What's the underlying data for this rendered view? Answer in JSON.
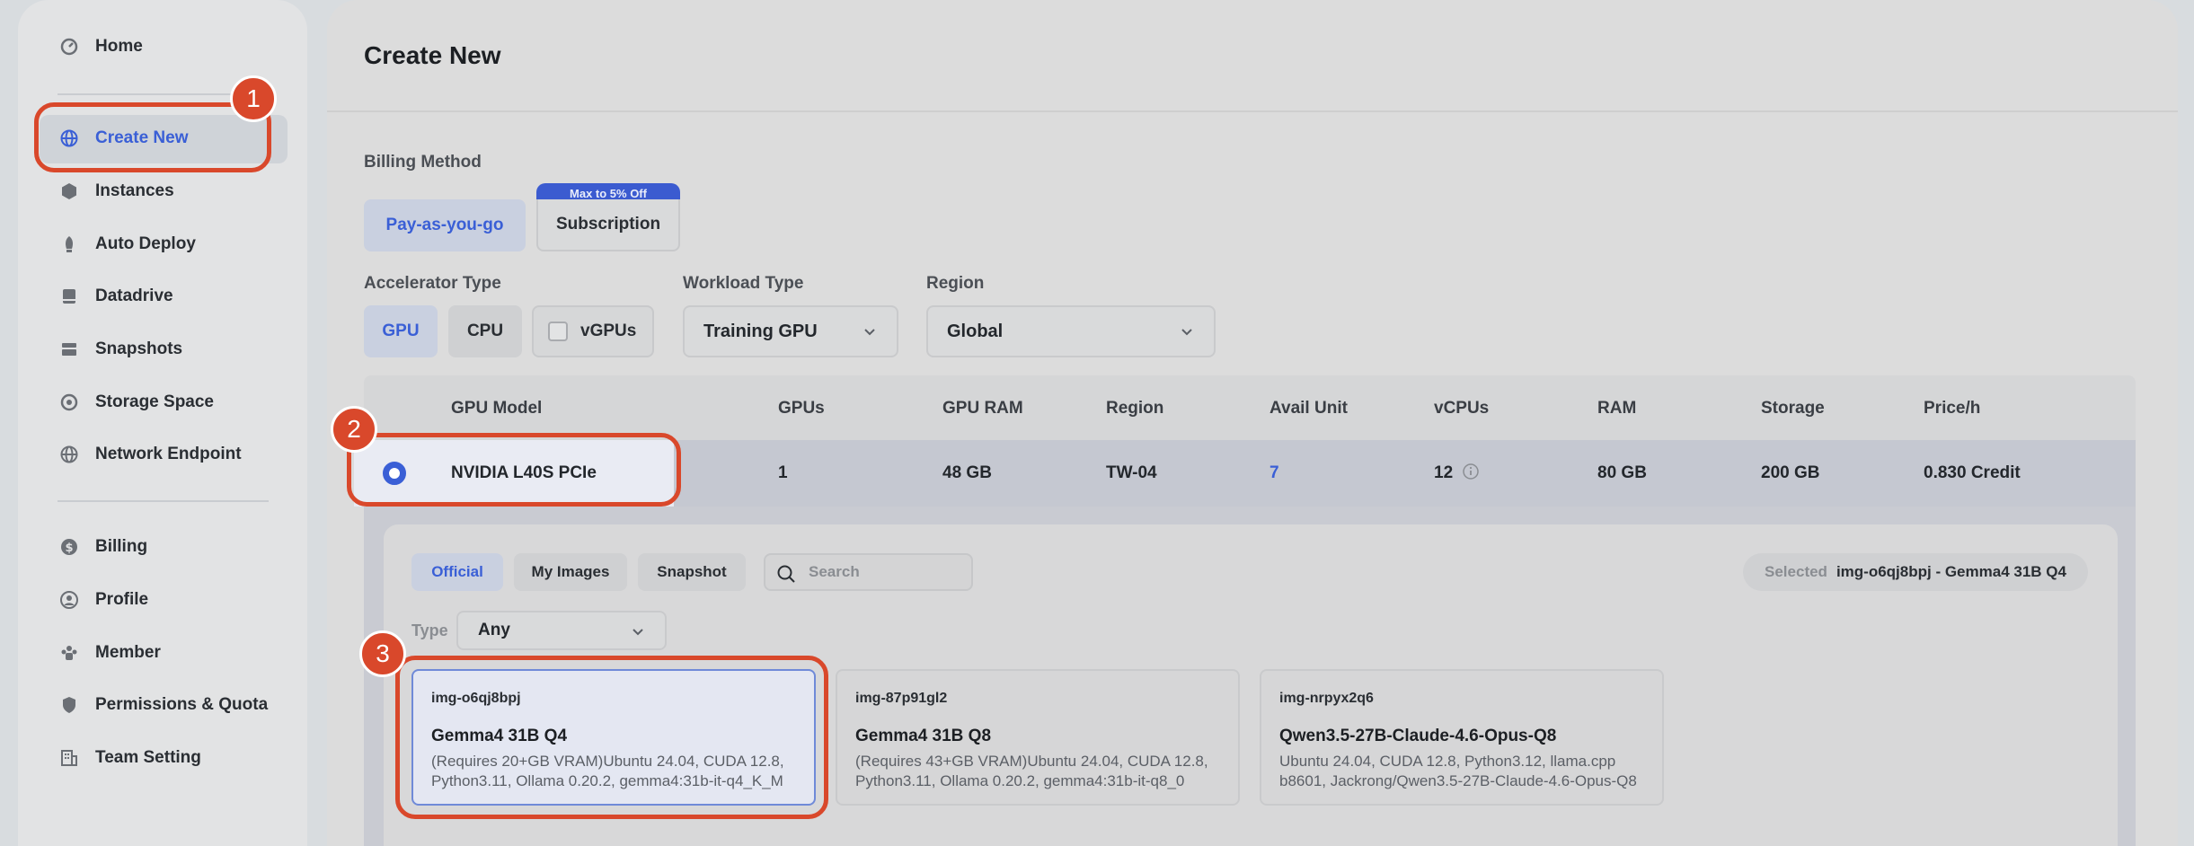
{
  "sidebar": {
    "items": [
      {
        "label": "Home",
        "icon": "dashboard-icon"
      },
      {
        "label": "Create New",
        "icon": "globe-icon"
      },
      {
        "label": "Instances",
        "icon": "cube-icon"
      },
      {
        "label": "Auto Deploy",
        "icon": "rocket-icon"
      },
      {
        "label": "Datadrive",
        "icon": "drive-icon"
      },
      {
        "label": "Snapshots",
        "icon": "snapshot-icon"
      },
      {
        "label": "Storage Space",
        "icon": "storage-icon"
      },
      {
        "label": "Network Endpoint",
        "icon": "network-icon"
      },
      {
        "label": "Billing",
        "icon": "dollar-icon"
      },
      {
        "label": "Profile",
        "icon": "user-icon"
      },
      {
        "label": "Member",
        "icon": "members-icon"
      },
      {
        "label": "Permissions & Quota",
        "icon": "shield-icon"
      },
      {
        "label": "Team Setting",
        "icon": "building-icon"
      }
    ]
  },
  "page": {
    "title": "Create New"
  },
  "billing": {
    "label": "Billing Method",
    "options": [
      "Pay-as-you-go",
      "Subscription"
    ],
    "badge": "Max to 5% Off"
  },
  "accelerator": {
    "label": "Accelerator Type",
    "options": [
      "GPU",
      "CPU",
      "vGPUs"
    ]
  },
  "workload": {
    "label": "Workload Type",
    "value": "Training GPU"
  },
  "region": {
    "label": "Region",
    "value": "Global"
  },
  "table": {
    "headers": [
      "GPU Model",
      "GPUs",
      "GPU RAM",
      "Region",
      "Avail Unit",
      "vCPUs",
      "RAM",
      "Storage",
      "Price/h"
    ],
    "row": {
      "model": "NVIDIA L40S PCIe",
      "gpus": "1",
      "gpu_ram": "48 GB",
      "region": "TW-04",
      "avail": "7",
      "vcpus": "12",
      "ram": "80 GB",
      "storage": "200 GB",
      "price": "0.830 Credit"
    }
  },
  "images": {
    "tabs": [
      "Official",
      "My Images",
      "Snapshot"
    ],
    "search_placeholder": "Search",
    "selected_label": "Selected",
    "selected_value": "img-o6qj8bpj - Gemma4 31B Q4",
    "type_label": "Type",
    "type_value": "Any",
    "cards": [
      {
        "id": "img-o6qj8bpj",
        "name": "Gemma4 31B Q4",
        "desc": "(Requires 20+GB VRAM)Ubuntu 24.04, CUDA 12.8, Python3.11, Ollama 0.20.2, gemma4:31b-it-q4_K_M"
      },
      {
        "id": "img-87p91gl2",
        "name": "Gemma4 31B Q8",
        "desc": "(Requires 43+GB VRAM)Ubuntu 24.04, CUDA 12.8, Python3.11, Ollama 0.20.2, gemma4:31b-it-q8_0"
      },
      {
        "id": "img-nrpyx2q6",
        "name": "Qwen3.5-27B-Claude-4.6-Opus-Q8",
        "desc": "Ubuntu 24.04, CUDA 12.8, Python3.12, llama.cpp b8601, Jackrong/Qwen3.5-27B-Claude-4.6-Opus-Q8"
      }
    ]
  },
  "annotations": [
    "1",
    "2",
    "3"
  ],
  "colors": {
    "accent": "#3a5fd6",
    "annotation": "#d9482b"
  }
}
